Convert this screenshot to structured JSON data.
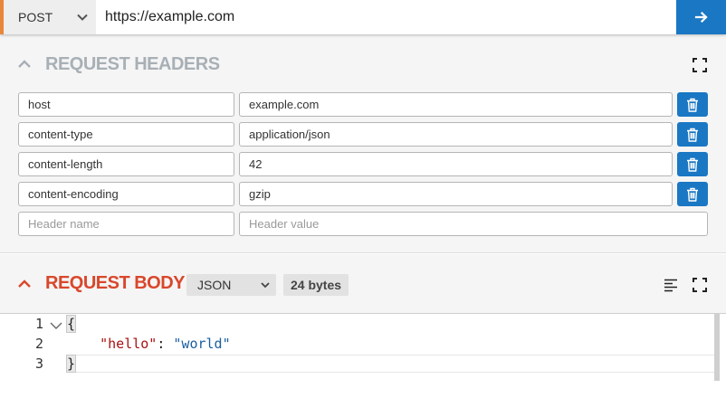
{
  "url_bar": {
    "method": "POST",
    "url": "https://example.com",
    "send_icon": "arrow-right-icon"
  },
  "headers_section": {
    "title": "REQUEST HEADERS",
    "rows": [
      {
        "name": "host",
        "value": "example.com"
      },
      {
        "name": "content-type",
        "value": "application/json"
      },
      {
        "name": "content-length",
        "value": "42"
      },
      {
        "name": "content-encoding",
        "value": "gzip"
      }
    ],
    "new_row": {
      "name_placeholder": "Header name",
      "value_placeholder": "Header value"
    }
  },
  "body_section": {
    "title": "REQUEST BODY",
    "content_type": "JSON",
    "size": "24 bytes",
    "editor": {
      "line_numbers": [
        "1",
        "2",
        "3"
      ],
      "line1": "{",
      "line2_key": "\"hello\"",
      "line2_sep": ": ",
      "line2_value": "\"world\"",
      "line3": "}"
    }
  },
  "colors": {
    "accent_blue": "#1a77c4",
    "method_accent": "#e8863a",
    "active_title": "#d9472b",
    "muted_title": "#a8b0b6"
  }
}
